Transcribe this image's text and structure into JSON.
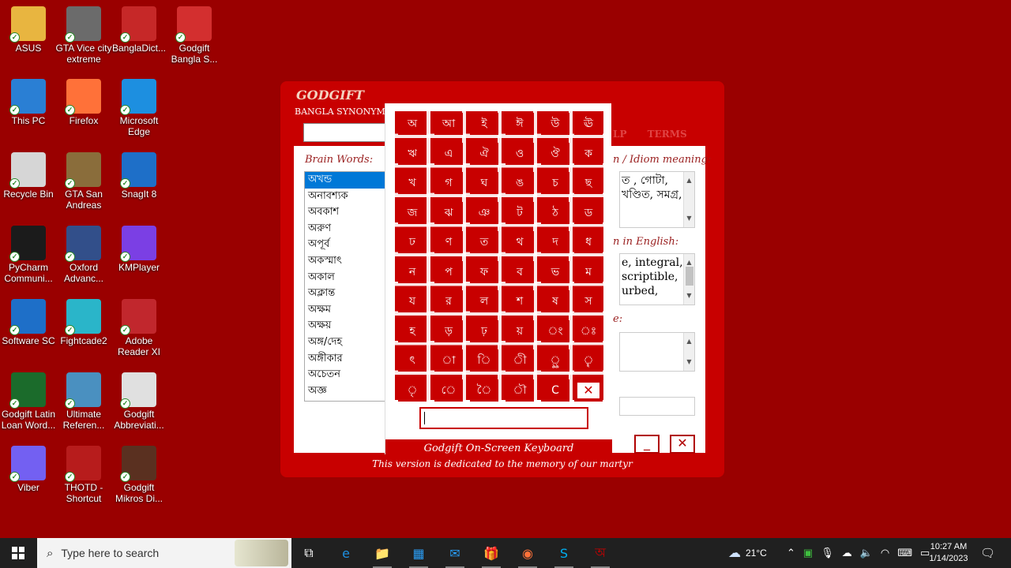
{
  "desktop": {
    "icons": [
      {
        "label": "ASUS",
        "icon": "folder-user-icon",
        "color": "#e8b540"
      },
      {
        "label": "GTA Vice city extreme",
        "icon": "gta-icon",
        "color": "#6b6b6b"
      },
      {
        "label": "BanglaDict...",
        "icon": "book-icon",
        "color": "#c62828"
      },
      {
        "label": "Godgift Bangla S...",
        "icon": "godgift-icon",
        "color": "#d32f2f"
      },
      {
        "label": "This PC",
        "icon": "computer-icon",
        "color": "#2a7fd4"
      },
      {
        "label": "Firefox",
        "icon": "firefox-icon",
        "color": "#ff7139"
      },
      {
        "label": "Microsoft Edge",
        "icon": "edge-icon",
        "color": "#1d8fe0"
      },
      {
        "label": "Recycle Bin",
        "icon": "recycle-bin-icon",
        "color": "#d6d6d6"
      },
      {
        "label": "GTA San Andreas",
        "icon": "gta-icon",
        "color": "#8a6d3b"
      },
      {
        "label": "SnagIt 8",
        "icon": "snagit-icon",
        "color": "#1e6fc8"
      },
      {
        "label": "PyCharm Communi...",
        "icon": "pycharm-icon",
        "color": "#1b1b1b"
      },
      {
        "label": "Oxford Advanc...",
        "icon": "oxford-icon",
        "color": "#324f8a"
      },
      {
        "label": "KMPlayer",
        "icon": "kmplayer-icon",
        "color": "#7b3fe4"
      },
      {
        "label": "Software SC",
        "icon": "folder-icon",
        "color": "#1e6fc8"
      },
      {
        "label": "Fightcade2",
        "icon": "fightcade-icon",
        "color": "#2ab5c9"
      },
      {
        "label": "Adobe Reader XI",
        "icon": "pdf-icon",
        "color": "#c1272d"
      },
      {
        "label": "Godgift Latin Loan Word...",
        "icon": "godgift-icon",
        "color": "#1b6b2b"
      },
      {
        "label": "Ultimate Referen...",
        "icon": "reference-icon",
        "color": "#4a90c0"
      },
      {
        "label": "Godgift Abbreviati...",
        "icon": "godgift-icon",
        "color": "#e0e0e0"
      },
      {
        "label": "Viber",
        "icon": "viber-icon",
        "color": "#7360f2"
      },
      {
        "label": "THOTD - Shortcut",
        "icon": "thotd-icon",
        "color": "#b71c1c"
      },
      {
        "label": "Godgift Mikros Di...",
        "icon": "godgift-icon",
        "color": "#5a3020"
      }
    ]
  },
  "app": {
    "title": "GODGIFT",
    "subtitle": "BANGLA SYNONYM",
    "tabs": [
      "LP",
      "TERMS"
    ],
    "brain_words_label": "Brain Words:",
    "words": [
      "অখন্ড",
      "অনাবশ্যক",
      "অবকাশ",
      "অরুণ",
      "অপূর্ব",
      "অকস্মাৎ",
      "অকাল",
      "অক্লান্ত",
      "অক্ষম",
      "অক্ষয়",
      "অঙ্গ/দেহ",
      "অঙ্গীকার",
      "অচেতন",
      "অজ্ঞ"
    ],
    "idiom_label": "n / Idiom meaning:",
    "idiom_text": "ত , গোটা,\nখণ্ডিত, সমগ্র,",
    "english_label": "n in English:",
    "english_text": "e, integral,\nscriptible,\nurbed,",
    "third_label": "e:",
    "minimize_label": "_",
    "close_label": "✕",
    "footer": "This version is dedicated to the memory of our martyr"
  },
  "keyboard": {
    "title": "Godgift On-Screen Keyboard",
    "rows": [
      [
        "অ",
        "আ",
        "ই",
        "ঈ",
        "উ",
        "ঊ"
      ],
      [
        "ঋ",
        "এ",
        "ঐ",
        "ও",
        "ঔ",
        "ক"
      ],
      [
        "খ",
        "গ",
        "ঘ",
        "ঙ",
        "চ",
        "ছ"
      ],
      [
        "জ",
        "ঝ",
        "ঞ",
        "ট",
        "ঠ",
        "ড"
      ],
      [
        "ঢ",
        "ণ",
        "ত",
        "থ",
        "দ",
        "ধ"
      ],
      [
        "ন",
        "প",
        "ফ",
        "ব",
        "ভ",
        "ম"
      ],
      [
        "য",
        "র",
        "ল",
        "শ",
        "ষ",
        "স"
      ],
      [
        "হ",
        "ড়",
        "ঢ়",
        "য়",
        "ং",
        "ঃ"
      ],
      [
        "ৎ",
        "া",
        "ি",
        "ী",
        "ৣ",
        "ৄ"
      ],
      [
        "ৃ",
        "ে",
        "ৈ",
        "ৗ",
        "C",
        "✕"
      ]
    ],
    "input_value": ""
  },
  "taskbar": {
    "search_placeholder": "Type here to search",
    "apps": [
      {
        "icon": "task-view-icon",
        "glyph": "⧉",
        "color": "#ffffff"
      },
      {
        "icon": "edge-icon",
        "glyph": "e",
        "color": "#1d8fe0"
      },
      {
        "icon": "file-explorer-icon",
        "glyph": "📁",
        "color": "#f0c040"
      },
      {
        "icon": "store-icon",
        "glyph": "▦",
        "color": "#2a9df4"
      },
      {
        "icon": "mail-icon",
        "glyph": "✉",
        "color": "#2a9df4"
      },
      {
        "icon": "gift-icon",
        "glyph": "🎁",
        "color": "#e53935"
      },
      {
        "icon": "firefox-icon",
        "glyph": "◉",
        "color": "#ff7139"
      },
      {
        "icon": "skype-icon",
        "glyph": "S",
        "color": "#00aff0"
      },
      {
        "icon": "godgift-icon",
        "glyph": "অ",
        "color": "#c80000"
      }
    ],
    "weather": "21°C",
    "time": "10:27 AM",
    "date": "1/14/2023"
  }
}
